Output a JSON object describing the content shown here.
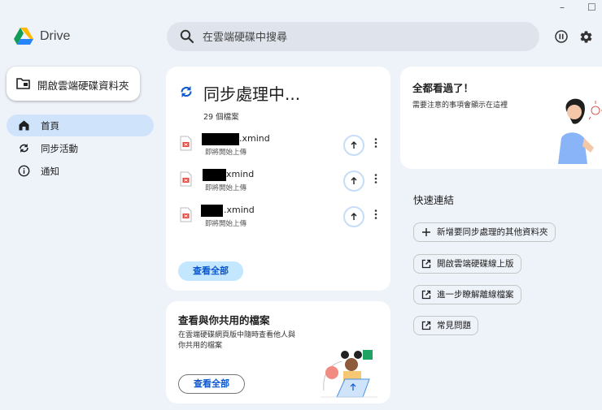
{
  "window": {
    "minimize_glyph": "–",
    "maximize_glyph": "☐"
  },
  "app": {
    "name": "Drive",
    "logo_icon": "google-drive-logo"
  },
  "search": {
    "placeholder": "在雲端硬碟中搜尋"
  },
  "header_actions": {
    "pause_icon": "pause-circle-icon",
    "settings_icon": "gear-icon"
  },
  "sidebar": {
    "open_folder_label": "開啟雲端硬碟資料夾",
    "items": [
      {
        "label": "首頁",
        "icon": "home-icon",
        "active": true
      },
      {
        "label": "同步活動",
        "icon": "sync-icon",
        "active": false
      },
      {
        "label": "通知",
        "icon": "info-icon",
        "active": false
      }
    ]
  },
  "sync": {
    "title": "同步處理中...",
    "file_count": "29 個檔案",
    "files": [
      {
        "name": ".xmind",
        "status": "即將開始上傳"
      },
      {
        "name": "xmind",
        "status": "即將開始上傳"
      },
      {
        "name": ".xmind",
        "status": "即將開始上傳"
      }
    ],
    "view_all": "查看全部"
  },
  "shared": {
    "title": "查看與你共用的檔案",
    "description": "在雲端硬碟網頁版中隨時查看他人與你共用的檔案",
    "view_all": "查看全部"
  },
  "notifications": {
    "title": "全都看過了！",
    "description": "需要注意的事項會顯示在這裡"
  },
  "quick_links": {
    "title": "快速連結",
    "items": [
      {
        "label": "新增要同步處理的其他資料夾",
        "icon": "plus-icon"
      },
      {
        "label": "開啟雲端硬碟線上版",
        "icon": "open-in-new-icon"
      },
      {
        "label": "進一步瞭解離線檔案",
        "icon": "open-in-new-icon"
      },
      {
        "label": "常見問題",
        "icon": "open-in-new-icon"
      }
    ]
  },
  "colors": {
    "accent": "#0b57d0",
    "active_nav": "#cfe4fb",
    "background": "#eef2f9"
  }
}
